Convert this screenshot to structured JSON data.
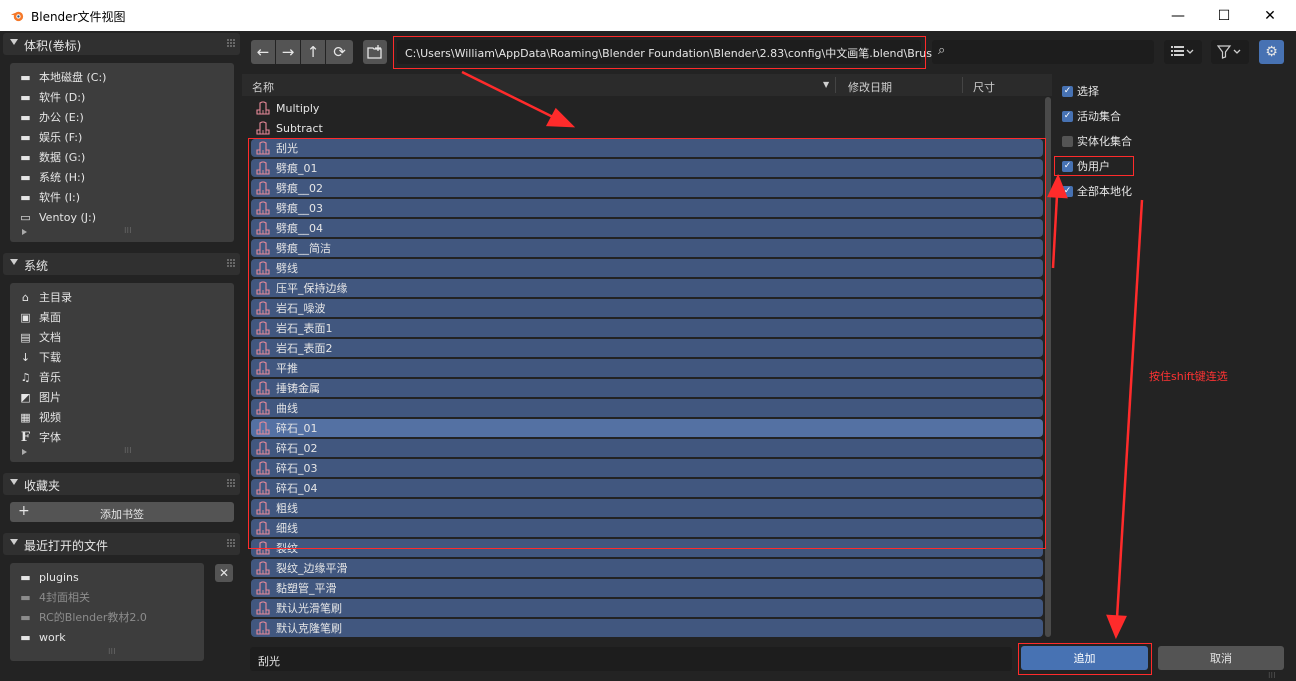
{
  "window": {
    "title": "Blender文件视图",
    "minimize": "—",
    "maximize": "☐",
    "close": "✕"
  },
  "sidebar": {
    "volumes": {
      "title": "体积(卷标)",
      "items": [
        "本地磁盘 (C:)",
        "软件 (D:)",
        "办公 (E:)",
        "娱乐 (F:)",
        "数据 (G:)",
        "系统 (H:)",
        "软件 (I:)",
        "Ventoy (J:)"
      ]
    },
    "system": {
      "title": "系统",
      "items": [
        "主目录",
        "桌面",
        "文档",
        "下载",
        "音乐",
        "图片",
        "视频",
        "字体"
      ]
    },
    "bookmarks": {
      "title": "收藏夹",
      "add_label": "添加书签"
    },
    "recent": {
      "title": "最近打开的文件",
      "items": [
        "plugins",
        "4封面相关",
        "RC的Blender教材2.0",
        "work"
      ]
    }
  },
  "toolbar": {
    "path": "C:\\Users\\William\\AppData\\Roaming\\Blender Foundation\\Blender\\2.83\\config\\中文画笔.blend\\Brush\\",
    "search_placeholder": ""
  },
  "list": {
    "columns": {
      "name": "名称",
      "date": "修改日期",
      "size": "尺寸"
    },
    "rows": [
      {
        "name": "Multiply",
        "state": "none"
      },
      {
        "name": "Subtract",
        "state": "none"
      },
      {
        "name": "刮光",
        "state": "sel"
      },
      {
        "name": "劈痕_01",
        "state": "sel"
      },
      {
        "name": "劈痕__02",
        "state": "sel"
      },
      {
        "name": "劈痕__03",
        "state": "sel"
      },
      {
        "name": "劈痕__04",
        "state": "sel"
      },
      {
        "name": "劈痕__简洁",
        "state": "sel"
      },
      {
        "name": "劈线",
        "state": "sel"
      },
      {
        "name": "压平_保持边缘",
        "state": "sel"
      },
      {
        "name": "岩石_噪波",
        "state": "sel"
      },
      {
        "name": "岩石_表面1",
        "state": "sel"
      },
      {
        "name": "岩石_表面2",
        "state": "sel"
      },
      {
        "name": "平推",
        "state": "sel"
      },
      {
        "name": "捶铸金属",
        "state": "sel"
      },
      {
        "name": "曲线",
        "state": "sel"
      },
      {
        "name": "碎石_01",
        "state": "active"
      },
      {
        "name": "碎石_02",
        "state": "sel"
      },
      {
        "name": "碎石_03",
        "state": "sel"
      },
      {
        "name": "碎石_04",
        "state": "sel"
      },
      {
        "name": "粗线",
        "state": "sel"
      },
      {
        "name": "细线",
        "state": "sel"
      },
      {
        "name": "裂纹",
        "state": "sel"
      },
      {
        "name": "裂纹_边缘平滑",
        "state": "sel"
      },
      {
        "name": "黏塑管_平滑",
        "state": "sel"
      },
      {
        "name": "默认光滑笔刷",
        "state": "sel"
      },
      {
        "name": "默认克隆笔刷",
        "state": "sel"
      }
    ]
  },
  "options": [
    {
      "label": "选择",
      "checked": true
    },
    {
      "label": "活动集合",
      "checked": true
    },
    {
      "label": "实体化集合",
      "checked": false
    },
    {
      "label": "伪用户",
      "checked": true
    },
    {
      "label": "全部本地化",
      "checked": true
    }
  ],
  "footer": {
    "filename": "刮光",
    "add_label": "追加",
    "cancel_label": "取消"
  },
  "annotation": {
    "text": "按住shift键连选"
  },
  "colors": {
    "accent": "#4772b3",
    "selected_row": "#41577f",
    "active_row": "#5471a3",
    "annotation_red": "#ff2b2b"
  }
}
